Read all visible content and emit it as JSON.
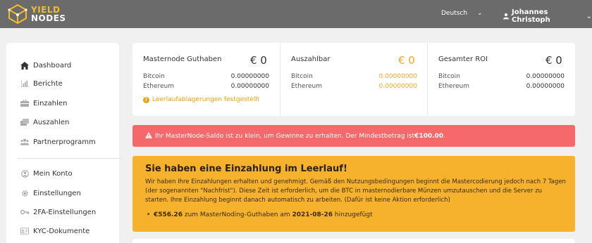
{
  "topbar": {
    "logo_line1": "YIELD",
    "logo_line2": "NODES",
    "language": "Deutsch",
    "user_name": "Johannes Christoph"
  },
  "sidebar": {
    "items": [
      {
        "label": "Dashboard",
        "icon": "home-icon",
        "active": true
      },
      {
        "label": "Berichte",
        "icon": "chart-icon"
      },
      {
        "label": "Einzahlen",
        "icon": "deposit-icon"
      },
      {
        "label": "Auszahlen",
        "icon": "withdraw-icon"
      },
      {
        "label": "Partnerprogramm",
        "icon": "users-icon"
      },
      {
        "label": "Mein Konto",
        "icon": "user-icon"
      },
      {
        "label": "Einstellungen",
        "icon": "gear-icon"
      },
      {
        "label": "2FA-Einstellungen",
        "icon": "key-icon"
      },
      {
        "label": "KYC-Dokumente",
        "icon": "id-card-icon"
      }
    ]
  },
  "stats": [
    {
      "title": "Masternode Guthaben",
      "amount": "€ 0",
      "rows": [
        {
          "label": "Bitcoin",
          "value": "0.00000000"
        },
        {
          "label": "Ethereum",
          "value": "0.00000000"
        }
      ],
      "notice": "Leerlaufablagerungen festgestellt"
    },
    {
      "title": "Auszahlbar",
      "amount": "€ 0",
      "rows": [
        {
          "label": "Bitcoin",
          "value": "0.00000000"
        },
        {
          "label": "Ethereum",
          "value": "0.00000000"
        }
      ]
    },
    {
      "title": "Gesamter ROI",
      "amount": "€ 0",
      "rows": [
        {
          "label": "Bitcoin",
          "value": "0.00000000"
        },
        {
          "label": "Ethereum",
          "value": "0.00000000"
        }
      ]
    }
  ],
  "alert_red": {
    "text": "Ihr MasterNode-Saldo ist zu klein, um Gewinne zu erhalten. Der Mindestbetrag ist ",
    "amount": "€100.00",
    "end": "."
  },
  "alert_yellow": {
    "heading": "Sie haben eine Einzahlung im Leerlauf!",
    "body": "Wir haben Ihre Einzahlungen erhalten und genehmigt. Gemäß den Nutzungsbedingungen beginnt die Mastercodierung jedoch nach 7 Tagen (der sogenannten \"Nachfrist\"). Diese Zeit ist erforderlich, um die BTC in masternodierbare Münzen umzutauschen und die Server zu starten. Ihre Einzahlung beginnt danach automatisch zu arbeiten. (Dafür ist keine Aktion erforderlich)",
    "item_amount": "€556.26",
    "item_mid": " zum MasterNoding-Guthaben am ",
    "item_date": "2021-08-26",
    "item_end": " hinzugefügt"
  },
  "colors": {
    "topbar": "#6b6b6b",
    "accent_yellow": "#f5a623",
    "alert_red": "#f5696b",
    "alert_yellow": "#f7b22d"
  }
}
